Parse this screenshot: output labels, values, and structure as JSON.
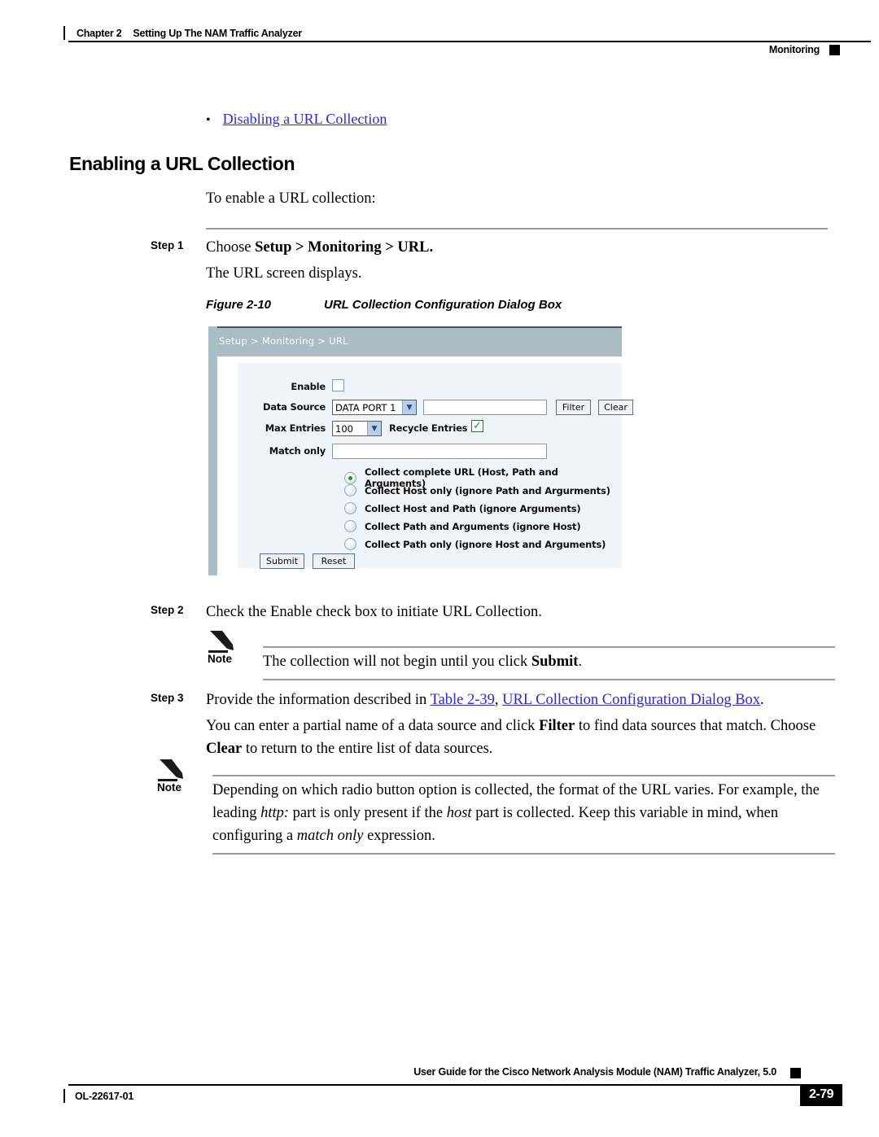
{
  "header": {
    "chapter": "Chapter 2",
    "chapter_title": "Setting Up The NAM Traffic Analyzer",
    "right_label": "Monitoring"
  },
  "bullet": {
    "marker": "•",
    "link_text": "Disabling a URL Collection"
  },
  "section": {
    "title": "Enabling a URL Collection",
    "intro": "To enable a URL collection:"
  },
  "steps": [
    {
      "label": "Step 1",
      "line1_prefix": "Choose ",
      "line1_bold": "Setup > Monitoring > URL.",
      "line2": "The URL screen displays."
    },
    {
      "label": "Step 2",
      "text": "Check the Enable check box to initiate URL Collection."
    },
    {
      "label": "Step 3",
      "text_prefix": "Provide the information described in ",
      "link_table": "Table 2-39",
      "text_mid": ", ",
      "link_title": "URL Collection Configuration Dialog Box",
      "text_suffix": ".",
      "para_a": "You can enter a partial name of a data source and click ",
      "para_a_bold1": "Filter",
      "para_a_mid": " to find data sources that match. Choose ",
      "para_a_bold2": "Clear",
      "para_a_end": " to return to the entire list of data sources."
    }
  ],
  "figure": {
    "caption_number": "Figure 2-10",
    "caption_title": "URL Collection Configuration Dialog Box"
  },
  "notes": [
    {
      "word": "Note",
      "icon": "pencil-icon",
      "text_prefix": "The collection will not begin until you click ",
      "text_bold": "Submit",
      "text_suffix": "."
    },
    {
      "word": "Note",
      "icon": "pencil-icon",
      "text_a": "Depending on which radio button option is collected, the format of the URL varies. For example, the",
      "text_b_prefix": "leading ",
      "text_b_it1": "http:",
      "text_b_mid": " part is only present if the ",
      "text_b_it2": "host",
      "text_b_end": " part is collected. Keep this variable in mind, when",
      "text_c_prefix": "configuring a ",
      "text_c_it": "match only",
      "text_c_end": " expression."
    }
  ],
  "app_screenshot": {
    "breadcrumb": "Setup > Monitoring > URL",
    "fields": {
      "enable_label": "Enable",
      "enable_checked": false,
      "data_source_label": "Data Source",
      "data_source_value": "DATA PORT 1",
      "data_source_filter_value": "",
      "filter_button": "Filter",
      "clear_button": "Clear",
      "max_entries_label": "Max Entries",
      "max_entries_value": "100",
      "recycle_entries_label": "Recycle Entries",
      "recycle_entries_checked": true,
      "match_only_label": "Match only",
      "match_only_value": ""
    },
    "radio_options": [
      {
        "label": "Collect complete URL (Host, Path and Arguments)",
        "selected": true
      },
      {
        "label": "Collect Host only (ignore Path and Argurments)",
        "selected": false
      },
      {
        "label": "Collect Host and Path (ignore Arguments)",
        "selected": false
      },
      {
        "label": "Collect Path and Arguments (ignore Host)",
        "selected": false
      },
      {
        "label": "Collect Path only (ignore Host and Arguments)",
        "selected": false
      }
    ],
    "buttons": {
      "submit": "Submit",
      "reset": "Reset"
    },
    "colors": {
      "header_bar": "#aabcc4",
      "left_bar": "#a9bfc6",
      "panel": "#eef4f8",
      "top_line": "#3d5670",
      "check_green": "#10a010",
      "radio_green": "#17a017"
    }
  },
  "footer": {
    "guide_title": "User Guide for the Cisco Network Analysis Module (NAM) Traffic Analyzer, 5.0",
    "doc_id": "OL-22617-01",
    "page_number": "2-79"
  }
}
